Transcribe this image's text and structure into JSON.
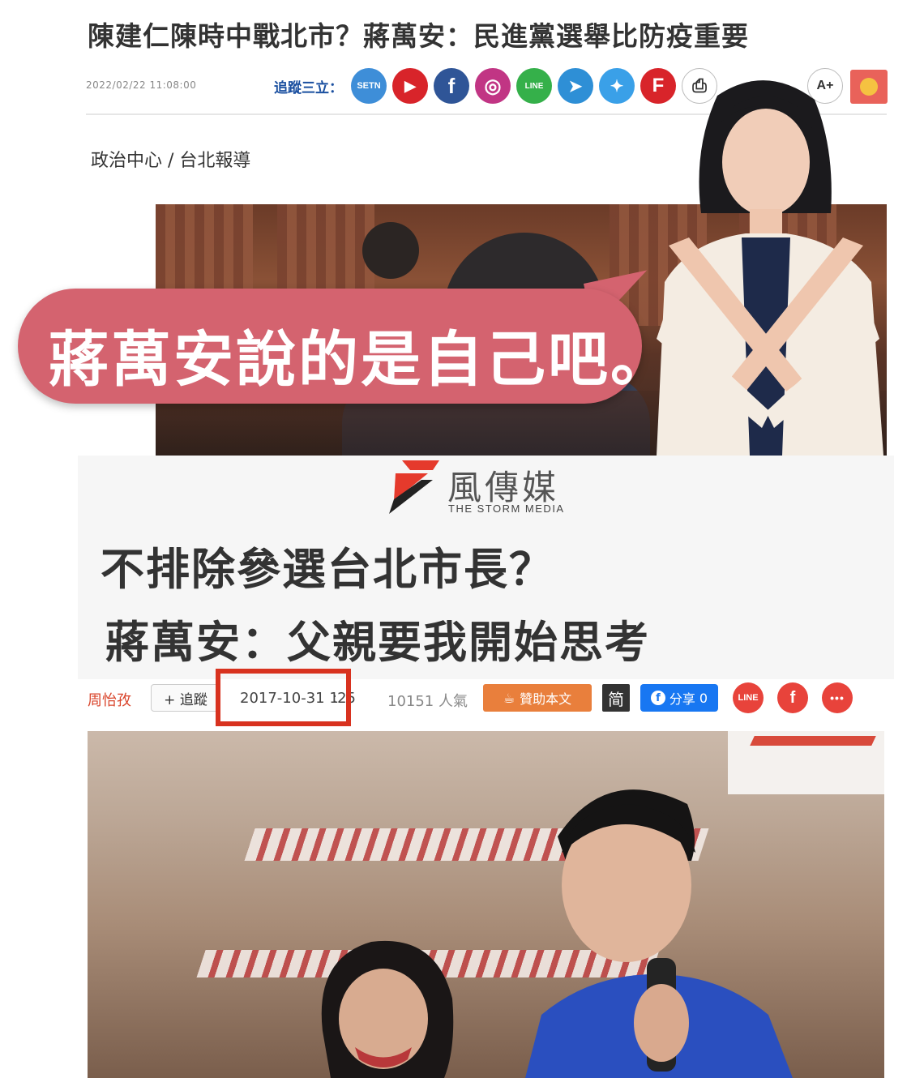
{
  "setn": {
    "title": "陳建仁陳時中戰北市？蔣萬安：民進黨選舉比防疫重要",
    "datetime": "2022/02/22 11:08:00",
    "follow_label": "追蹤三立：",
    "share_icons": [
      {
        "name": "setn-icon",
        "label": "SETN",
        "color": "#3e8ed8"
      },
      {
        "name": "youtube-icon",
        "label": "▶",
        "color": "#d8242a"
      },
      {
        "name": "facebook-icon",
        "label": "f",
        "color": "#2f5597"
      },
      {
        "name": "instagram-icon",
        "label": "◎",
        "color": "#c13584"
      },
      {
        "name": "line-icon",
        "label": "LINE",
        "color": "#35b04a"
      },
      {
        "name": "telegram-icon",
        "label": "➤",
        "color": "#2e8fd6"
      },
      {
        "name": "twitter-icon",
        "label": "✦",
        "color": "#3aa0e8"
      },
      {
        "name": "flipboard-icon",
        "label": "F",
        "color": "#d8242a"
      },
      {
        "name": "print-icon",
        "label": "⎙",
        "color": "#ffffff"
      }
    ],
    "font_size_button": "A+",
    "byline": "政治中心 / 台北報導"
  },
  "callout": {
    "text": "蔣萬安說的是自己吧。",
    "bubble_color": "#d4636f"
  },
  "storm": {
    "logo_cn": "風傳媒",
    "logo_en": "THE STORM MEDIA",
    "headline_line1": "不排除參選台北市長？",
    "headline_line2": "蔣萬安：父親要我開始思考",
    "author": "周怡孜",
    "follow_button": "+ 追蹤",
    "date": "2017-10-31 1",
    "time_tail": ":25",
    "views": "10151 人氣",
    "sponsor_button": "贊助本文",
    "simplified_button": "简",
    "fb_share_label": "分享",
    "fb_share_count": "0",
    "line_label": "LINE",
    "fb_label": "f",
    "more_label": "•••",
    "highlight_color": "#d8321f"
  }
}
